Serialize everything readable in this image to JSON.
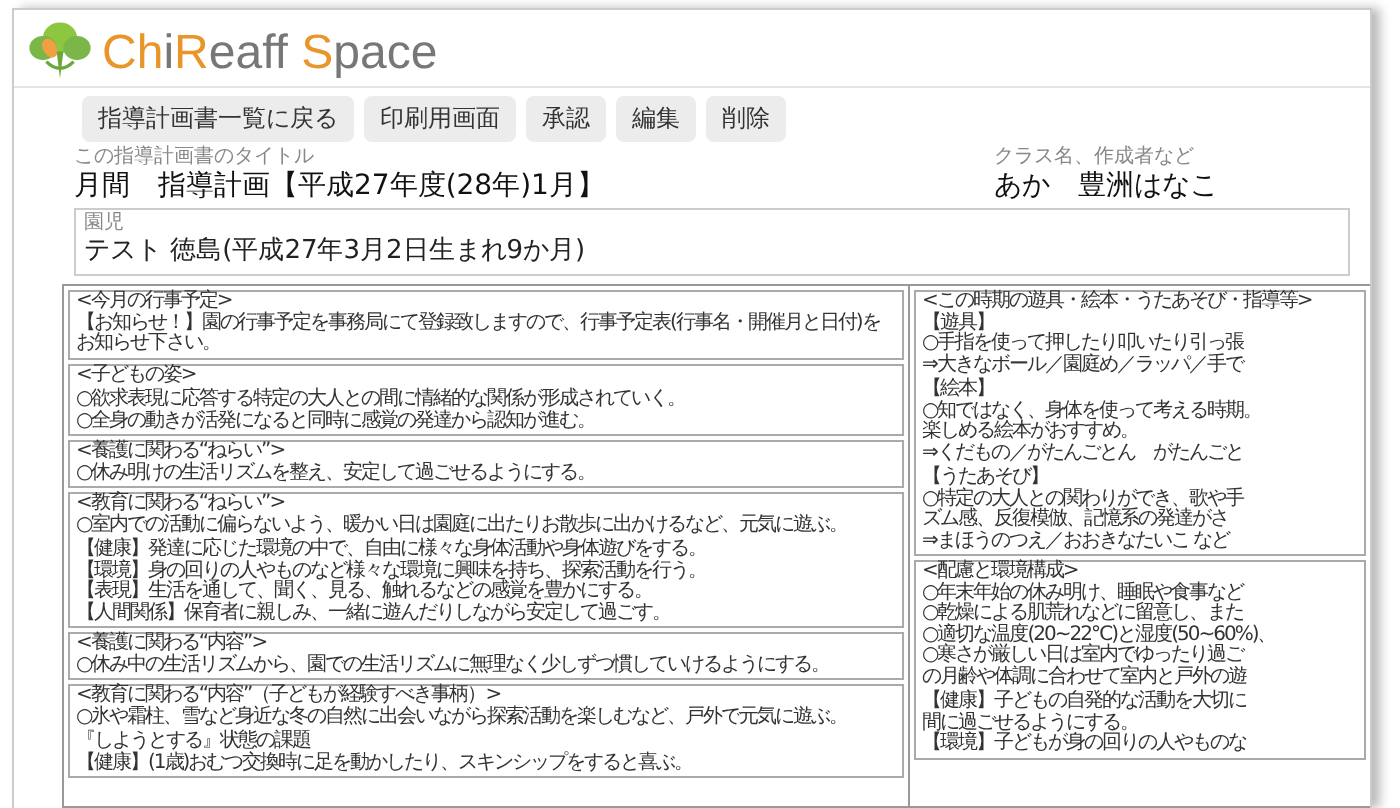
{
  "logo": {
    "parts": [
      {
        "text": "Ch",
        "color": "#e8962a"
      },
      {
        "text": "i",
        "color": "#777777"
      },
      {
        "text": "R",
        "color": "#e8962a"
      },
      {
        "text": "eaff ",
        "color": "#777777"
      },
      {
        "text": "S",
        "color": "#e8962a"
      },
      {
        "text": "pace",
        "color": "#777777"
      }
    ]
  },
  "toolbar": [
    "指導計画書一覧に戻る",
    "印刷用画面",
    "承認",
    "編集",
    "削除"
  ],
  "title": {
    "label": "この指導計画書のタイトル",
    "value": "月間　指導計画【平成27年度(28年)1月】"
  },
  "author": {
    "label": "クラス名、作成者など",
    "value": "あか　豊洲はなこ"
  },
  "child": {
    "label": "園児",
    "value": "テスト 徳島(平成27年3月2日生まれ9か月)"
  },
  "plan": {
    "columns": [
      [
        {
          "paragraphs": [
            [
              "<今月の行事予定>",
              "【お知らせ！】園の行事予定を事務局にて登録致しますので、行事予定表(行事名・開催月と日付)をお知らせ下さい。"
            ]
          ]
        },
        {
          "paragraphs": [
            [
              "<子どもの姿>"
            ],
            [
              "○欲求表現に応答する特定の大人との間に情緒的な関係が形成されていく。",
              "○全身の動きが活発になると同時に感覚の発達から認知が進む。"
            ]
          ]
        },
        {
          "paragraphs": [
            [
              "<養護に関わる“ねらい”>",
              "○休み明けの生活リズムを整え、安定して過ごせるようにする。"
            ]
          ]
        },
        {
          "paragraphs": [
            [
              "<教育に関わる“ねらい”>",
              "○室内での活動に偏らないよう、暖かい日は園庭に出たりお散歩に出かけるなど、元気に遊ぶ。"
            ],
            [
              "【健康】発達に応じた環境の中で、自由に様々な身体活動や身体遊びをする。",
              "【環境】身の回りの人やものなど様々な環境に興味を持ち、探索活動を行う。",
              "【表現】生活を通して、聞く、見る、触れるなどの感覚を豊かにする。",
              "【人間関係】保育者に親しみ、一緒に遊んだりしながら安定して過ごす。"
            ]
          ]
        },
        {
          "paragraphs": [
            [
              "<養護に関わる“内容”>",
              "○休み中の生活リズムから、園での生活リズムに無理なく少しずつ慣していけるようにする。"
            ]
          ]
        },
        {
          "paragraphs": [
            [
              "<教育に関わる“内容”（子どもが経験すべき事柄）>",
              "○氷や霜柱、雪など身近な冬の自然に出会いながら探索活動を楽しむなど、戸外で元気に遊ぶ。"
            ],
            [
              "『しようとする』状態の課題",
              "【健康】(1歳)おむつ交換時に足を動かしたり、スキンシップをすると喜ぶ。"
            ]
          ]
        }
      ],
      [
        {
          "paragraphs": [
            [
              "<この時期の遊具・絵本・うたあそび・指導等>",
              "【遊具】",
              "○手指を使って押したり叩いたり引っ張",
              "⇒大きなボール／園庭め／ラッパ／手で"
            ],
            [
              "【絵本】",
              "○知ではなく、身体を使って考える時期。",
              "楽しめる絵本がおすすめ。",
              "⇒くだもの／がたんごとん　がたんごと"
            ],
            [
              "【うたあそび】",
              "○特定の大人との関わりができ、歌や手",
              "ズム感、反復模倣、記憶系の発達がさ",
              "⇒まほうのつえ／おおきなたいこ など"
            ]
          ]
        },
        {
          "paragraphs": [
            [
              "<配慮と環境構成>",
              "○年末年始の休み明け、睡眠や食事など",
              "○乾燥による肌荒れなどに留意し、また",
              "○適切な温度(20~22℃)と湿度(50~60%)、",
              "○寒さが厳しい日は室内でゆったり過ご",
              "の月齢や体調に合わせて室内と戸外の遊"
            ],
            [
              "【健康】子どもの自発的な活動を大切に",
              "間に過ごせるようにする。",
              "【環境】子どもが身の回りの人やものな"
            ]
          ]
        }
      ]
    ]
  }
}
